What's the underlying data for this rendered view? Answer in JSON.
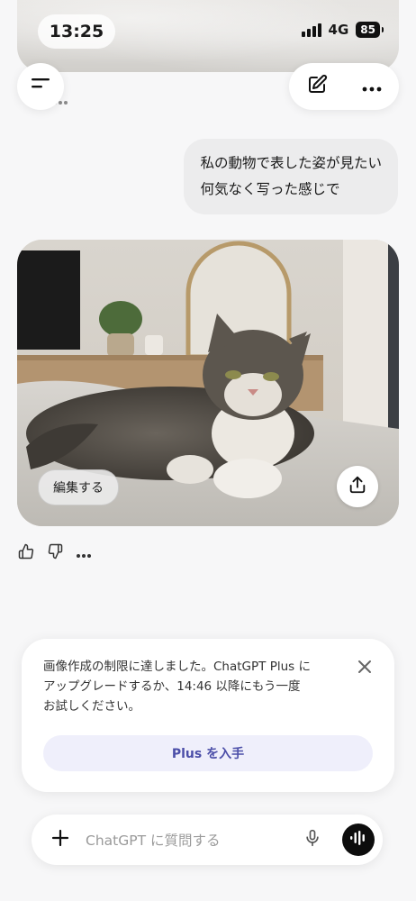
{
  "status_bar": {
    "time": "13:25",
    "network": "4G",
    "battery": "85"
  },
  "icons": {
    "menu": "menu-icon",
    "new_chat": "edit-icon",
    "more": "more-horizontal-icon",
    "share": "share-icon",
    "thumbs_up": "thumbs-up-icon",
    "thumbs_down": "thumbs-down-icon",
    "close": "close-icon",
    "plus": "plus-icon",
    "mic": "microphone-icon",
    "voice": "waveform-icon"
  },
  "conversation": {
    "user_message_line1": "私の動物で表した姿が見たい",
    "user_message_line2": "何気なく写った感じで",
    "image_edit_label": "編集する"
  },
  "limit_card": {
    "line1": "画像作成の制限に達しました。ChatGPT Plus に",
    "line2": "アップグレードするか、14:46 以降にもう一度",
    "line3": "お試しください。",
    "button_label": "Plus を入手"
  },
  "composer": {
    "placeholder": "ChatGPT に質問する"
  },
  "colors": {
    "background": "#f7f7f8",
    "user_bubble": "#ececed",
    "plus_button_bg": "#efeffb",
    "plus_button_text": "#4b4ea8",
    "voice_button": "#0d0d0d"
  }
}
